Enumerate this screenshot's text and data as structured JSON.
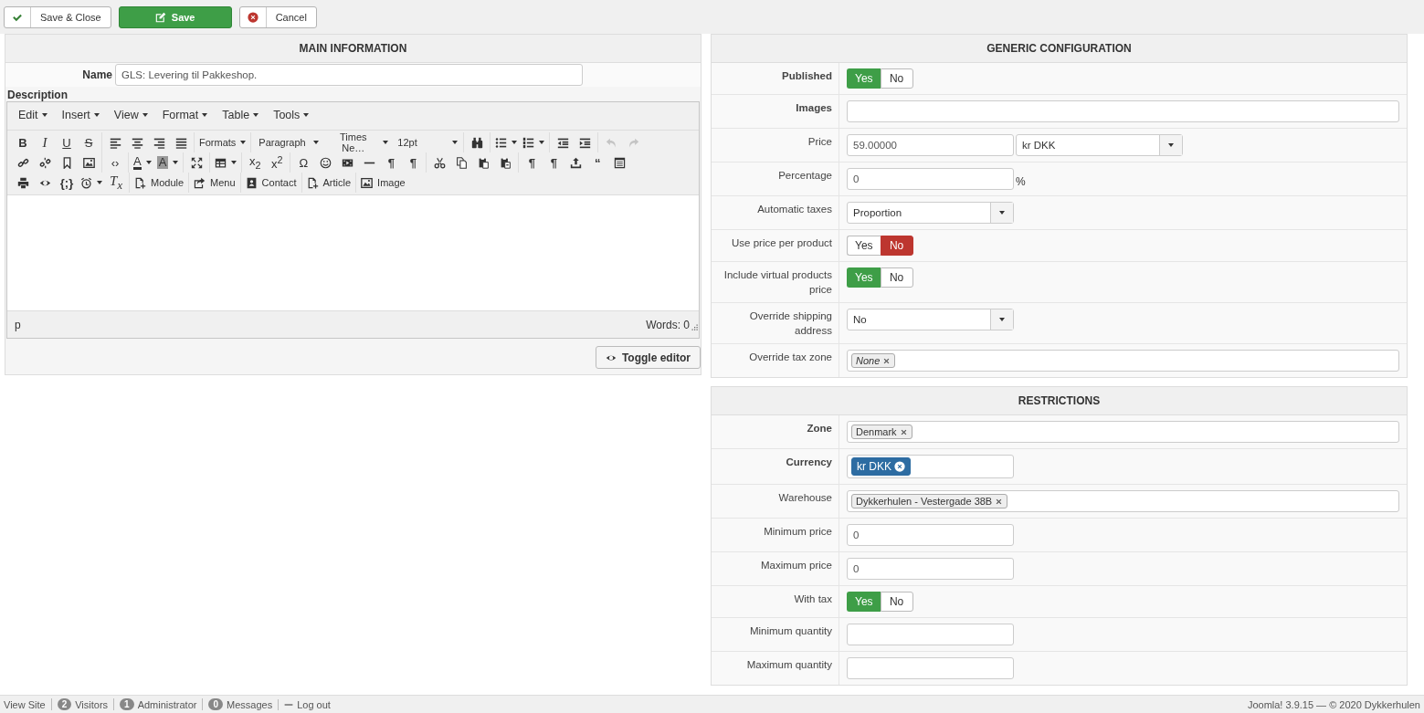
{
  "toolbar": {
    "buttons": [
      {
        "kind": "apply",
        "label": "Save & Close"
      },
      {
        "kind": "primary",
        "label": "Save"
      },
      {
        "kind": "cancel",
        "label": "Cancel"
      }
    ]
  },
  "main_information": {
    "title": "MAIN INFORMATION",
    "name_label": "Name",
    "name_value": "GLS: Levering til Pakkeshop.",
    "description_label": "Description",
    "editor": {
      "menus": [
        "Edit",
        "Insert",
        "View",
        "Format",
        "Table",
        "Tools"
      ],
      "toolbar_rows": [
        [
          [
            {
              "kind": "glyph",
              "text": "B",
              "disabled": false
            },
            {
              "kind": "glyph",
              "text": "I",
              "disabled": false
            },
            {
              "kind": "glyph",
              "text": "U",
              "disabled": false
            },
            {
              "kind": "glyph",
              "text": "S",
              "disabled": false
            }
          ],
          [
            {
              "kind": "icon",
              "disabled": false
            },
            {
              "kind": "icon",
              "disabled": false
            },
            {
              "kind": "icon",
              "disabled": false
            },
            {
              "kind": "icon",
              "disabled": false
            }
          ],
          [
            {
              "kind": "menu",
              "text": "Formats",
              "disabled": false
            }
          ],
          [
            {
              "kind": "select",
              "text": "Paragraph",
              "disabled": false
            },
            {
              "kind": "select",
              "text": "Times Ne…",
              "disabled": false
            },
            {
              "kind": "select",
              "text": "12pt",
              "disabled": false
            }
          ],
          [
            {
              "kind": "icon",
              "disabled": false
            }
          ],
          [
            {
              "kind": "icon",
              "caret": true,
              "disabled": false
            },
            {
              "kind": "icon",
              "caret": true,
              "disabled": false
            }
          ],
          [
            {
              "kind": "icon",
              "disabled": false
            },
            {
              "kind": "icon",
              "disabled": false
            }
          ],
          [
            {
              "kind": "icon",
              "disabled": true
            },
            {
              "kind": "icon",
              "disabled": true
            }
          ]
        ],
        [
          [
            {
              "kind": "icon",
              "disabled": false
            },
            {
              "kind": "icon",
              "disabled": false
            },
            {
              "kind": "icon",
              "disabled": false
            },
            {
              "kind": "icon",
              "disabled": false
            }
          ],
          [
            {
              "kind": "glyph",
              "text": "‹›",
              "disabled": false
            }
          ],
          [
            {
              "kind": "glyph",
              "text": "A",
              "caret": true,
              "disabled": false
            },
            {
              "kind": "glyph",
              "text": "A",
              "caret": true,
              "disabled": false
            }
          ],
          [
            {
              "kind": "icon",
              "disabled": false
            }
          ],
          [
            {
              "kind": "icon",
              "caret": true,
              "disabled": false
            }
          ],
          [
            {
              "kind": "glyph",
              "text": "x$_{2}$",
              "disabled": false
            },
            {
              "kind": "glyph",
              "text": "x$^{2}$",
              "disabled": false
            }
          ],
          [
            {
              "kind": "glyph",
              "text": "Ω",
              "disabled": false
            },
            {
              "kind": "icon",
              "disabled": false
            },
            {
              "kind": "icon",
              "disabled": false
            },
            {
              "kind": "icon",
              "disabled": false
            },
            {
              "kind": "glyph",
              "text": "¶",
              "disabled": false
            },
            {
              "kind": "glyph",
              "text": "¶",
              "disabled": false
            }
          ],
          [
            {
              "kind": "icon",
              "disabled": false
            },
            {
              "kind": "icon",
              "disabled": false
            },
            {
              "kind": "icon",
              "disabled": false
            },
            {
              "kind": "icon",
              "disabled": false
            }
          ],
          [
            {
              "kind": "glyph",
              "text": "¶",
              "disabled": false
            },
            {
              "kind": "glyph",
              "text": "¶",
              "disabled": false
            },
            {
              "kind": "icon",
              "disabled": false
            },
            {
              "kind": "glyph",
              "text": "“",
              "disabled": false
            },
            {
              "kind": "icon",
              "disabled": false
            }
          ]
        ],
        [
          [
            {
              "kind": "icon",
              "disabled": false
            },
            {
              "kind": "icon",
              "disabled": false
            },
            {
              "kind": "glyph",
              "text": "{;}",
              "disabled": false
            },
            {
              "kind": "icon",
              "caret": true,
              "disabled": false
            },
            {
              "kind": "glyph",
              "text": "T$_{x}$",
              "disabled": false
            }
          ],
          [
            {
              "kind": "labeled",
              "text": "Module",
              "disabled": false
            }
          ],
          [
            {
              "kind": "labeled",
              "text": "Menu",
              "disabled": false
            }
          ],
          [
            {
              "kind": "labeled",
              "text": "Contact",
              "disabled": false
            }
          ],
          [
            {
              "kind": "labeled",
              "text": "Article",
              "disabled": false
            }
          ],
          [
            {
              "kind": "labeled",
              "text": "Image",
              "disabled": false
            }
          ]
        ]
      ],
      "path": "p",
      "word_count": "Words: 0"
    },
    "toggle_button": "Toggle editor"
  },
  "generic_configuration": {
    "title": "GENERIC CONFIGURATION",
    "rows": [
      {
        "label": "Published",
        "bold": true,
        "controls": [
          {
            "kind": "toggle",
            "options": [
              {
                "label": "Yes",
                "selected": true
              },
              {
                "label": "No",
                "selected": false
              }
            ]
          }
        ]
      },
      {
        "label": "Images",
        "bold": true,
        "controls": [
          {
            "kind": "text",
            "wide": true
          }
        ]
      },
      {
        "label": "Price",
        "bold": false,
        "controls": [
          {
            "kind": "text",
            "value": "59.00000",
            "wide": false
          },
          {
            "kind": "select",
            "value": "kr DKK"
          }
        ]
      },
      {
        "label": "Percentage",
        "bold": false,
        "controls": [
          {
            "kind": "text",
            "value": "0",
            "wide": false
          },
          {
            "kind": "unit",
            "text": "%"
          }
        ]
      },
      {
        "label": "Automatic taxes",
        "bold": false,
        "controls": [
          {
            "kind": "select",
            "value": "Proportion"
          }
        ]
      },
      {
        "label": "Use price per product",
        "bold": false,
        "controls": [
          {
            "kind": "toggle",
            "options": [
              {
                "label": "Yes",
                "selected": false
              },
              {
                "label": "No",
                "selected": true
              }
            ]
          }
        ]
      },
      {
        "label": "Include virtual products price",
        "bold": false,
        "controls": [
          {
            "kind": "toggle",
            "options": [
              {
                "label": "Yes",
                "selected": true
              },
              {
                "label": "No",
                "selected": false
              }
            ]
          }
        ]
      },
      {
        "label": "Override shipping address",
        "bold": false,
        "controls": [
          {
            "kind": "select",
            "value": "No"
          }
        ]
      },
      {
        "label": "Override tax zone",
        "bold": false,
        "controls": [
          {
            "kind": "tags",
            "wide": true,
            "tags": [
              {
                "text": "None",
                "kind": "placeholder"
              }
            ]
          }
        ]
      }
    ]
  },
  "restrictions": {
    "title": "RESTRICTIONS",
    "rows": [
      {
        "label": "Zone",
        "bold": true,
        "controls": [
          {
            "kind": "tags",
            "wide": true,
            "tags": [
              {
                "text": "Denmark",
                "kind": "plain"
              }
            ]
          }
        ]
      },
      {
        "label": "Currency",
        "bold": true,
        "controls": [
          {
            "kind": "tags",
            "wide": false,
            "tags": [
              {
                "text": "kr DKK",
                "kind": "primary"
              }
            ]
          }
        ]
      },
      {
        "label": "Warehouse",
        "bold": false,
        "controls": [
          {
            "kind": "tags",
            "wide": true,
            "tags": [
              {
                "text": "Dykkerhulen - Vestergade 38B",
                "kind": "plain"
              }
            ]
          }
        ]
      },
      {
        "label": "Minimum price",
        "bold": false,
        "controls": [
          {
            "kind": "text",
            "value": "0",
            "wide": false
          }
        ]
      },
      {
        "label": "Maximum price",
        "bold": false,
        "controls": [
          {
            "kind": "text",
            "value": "0",
            "wide": false
          }
        ]
      },
      {
        "label": "With tax",
        "bold": false,
        "controls": [
          {
            "kind": "toggle",
            "options": [
              {
                "label": "Yes",
                "selected": true
              },
              {
                "label": "No",
                "selected": false
              }
            ]
          }
        ]
      },
      {
        "label": "Minimum quantity",
        "bold": false,
        "controls": [
          {
            "kind": "text",
            "wide": false
          }
        ]
      },
      {
        "label": "Maximum quantity",
        "bold": false,
        "controls": [
          {
            "kind": "text",
            "wide": false
          }
        ]
      }
    ]
  },
  "status_bar": {
    "left": [
      {
        "kind": "link",
        "text": "View Site"
      },
      {
        "kind": "badge",
        "count": "2",
        "text": "Visitors"
      },
      {
        "kind": "badge",
        "count": "1",
        "text": "Administrator"
      },
      {
        "kind": "badge",
        "count": "0",
        "text": "Messages"
      },
      {
        "kind": "logout",
        "text": "Log out"
      }
    ],
    "right": "Joomla! 3.9.15 — © 2020 Dykkerhulen"
  }
}
